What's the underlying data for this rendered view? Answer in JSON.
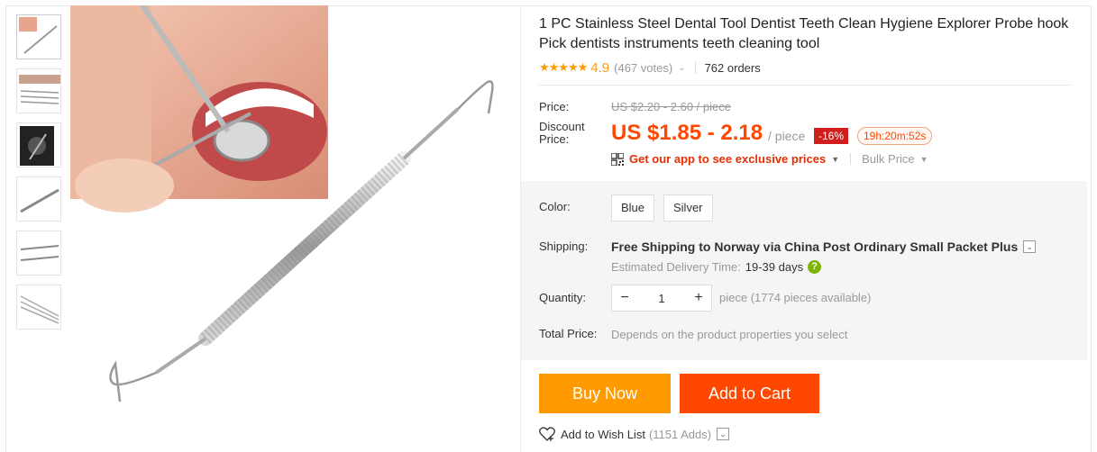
{
  "product": {
    "title": "1 PC Stainless Steel Dental Tool Dentist Teeth Clean Hygiene Explorer Probe hook Pick dentists instruments teeth cleaning tool",
    "stars": "★★★★★",
    "rating": "4.9",
    "votes": "(467 votes)",
    "orders": "762 orders"
  },
  "price": {
    "price_label": "Price:",
    "original": "US $2.20 - 2.60 / piece",
    "discount_label": "Discount Price:",
    "discount": "US $1.85 - 2.18",
    "per_piece": "/ piece",
    "off_badge": "-16%",
    "timer": "19h:20m:52s",
    "app_link": "Get our app to see exclusive prices",
    "bulk": "Bulk Price"
  },
  "options": {
    "color_label": "Color:",
    "colors": [
      "Blue",
      "Silver"
    ],
    "shipping_label": "Shipping:",
    "shipping_text": "Free Shipping to Norway via China Post Ordinary Small Packet Plus",
    "delivery_label": "Estimated Delivery Time:",
    "delivery_days": "19-39 days",
    "quantity_label": "Quantity:",
    "quantity_value": "1",
    "quantity_info": "piece (1774 pieces available)",
    "total_label": "Total Price:",
    "total_value": "Depends on the product properties you select"
  },
  "actions": {
    "buy_now": "Buy Now",
    "add_to_cart": "Add to Cart",
    "wish_list": "Add to Wish List",
    "wish_adds": "(1151 Adds)"
  },
  "colors": {
    "accent_orange": "#ff9a00",
    "accent_red": "#ff4700",
    "badge_red": "#d01d1d"
  }
}
